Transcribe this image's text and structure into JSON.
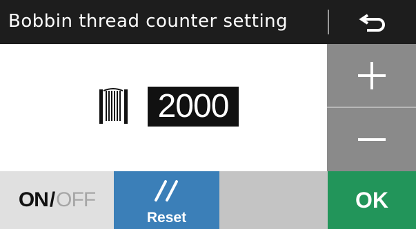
{
  "header": {
    "title": "Bobbin thread counter setting",
    "back_icon": "return-arrow-icon"
  },
  "counter": {
    "icon": "bobbin-thread-icon",
    "value": "2000"
  },
  "controls": {
    "increment_icon": "plus-icon",
    "decrement_icon": "minus-icon"
  },
  "footer": {
    "on_label": "ON",
    "separator": "/",
    "off_label": "OFF",
    "reset_icon": "double-slash-icon",
    "reset_label": "Reset",
    "ok_label": "OK"
  },
  "colors": {
    "title_bar": "#1d1d1d",
    "side_buttons": "#8a8a8a",
    "reset_button": "#3b7fb8",
    "ok_button": "#22955a",
    "off_text": "#a6a6a6"
  }
}
